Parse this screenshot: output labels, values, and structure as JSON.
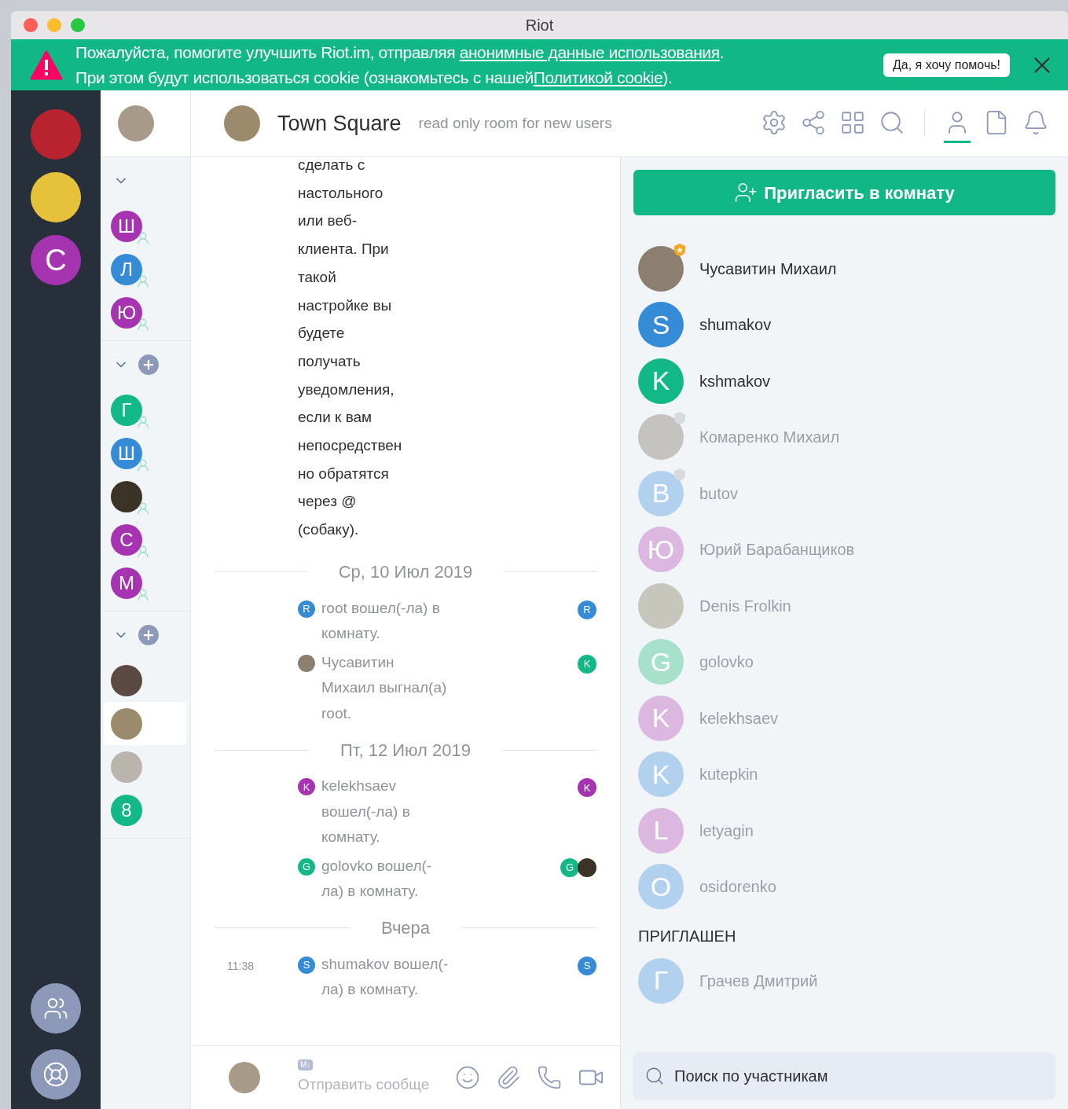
{
  "window": {
    "title": "Riot"
  },
  "banner": {
    "line1": [
      {
        "text": "Пожалуйста, помогите улучшить Riot.im, отправляя ",
        "kind": "plain"
      },
      {
        "text": "анонимные данные использования",
        "kind": "link"
      },
      {
        "text": ".",
        "kind": "plain"
      }
    ],
    "line2": [
      {
        "text": "При этом будут использоваться cookie (ознакомьтесь с нашей",
        "kind": "plain"
      },
      {
        "text": "Политикой cookie",
        "kind": "link"
      },
      {
        "text": ").",
        "kind": "plain"
      }
    ],
    "accept_button": "Да, я хочу помочь!"
  },
  "spaces": [
    {
      "kind": "photo",
      "color": "#b8232f"
    },
    {
      "kind": "photo",
      "color": "#e6c23a"
    },
    {
      "kind": "letter",
      "letter": "C",
      "color": "#a633b0"
    }
  ],
  "room_list": {
    "sections": [
      {
        "expanded": true,
        "can_add": false,
        "rooms": [
          {
            "kind": "letter",
            "letter": "Ш",
            "color": "#a633b0",
            "dm": true,
            "selected": false
          },
          {
            "kind": "letter",
            "letter": "Л",
            "color": "#368bd6",
            "dm": true,
            "selected": false
          },
          {
            "kind": "letter",
            "letter": "Ю",
            "color": "#a633b0",
            "dm": true,
            "selected": false
          }
        ]
      },
      {
        "expanded": true,
        "can_add": true,
        "rooms": [
          {
            "kind": "letter",
            "letter": "Г",
            "color": "#12b886",
            "dm": true,
            "selected": false
          },
          {
            "kind": "letter",
            "letter": "Ш",
            "color": "#368bd6",
            "dm": true,
            "selected": false
          },
          {
            "kind": "photo",
            "color": "#3b3326",
            "dm": true,
            "selected": false
          },
          {
            "kind": "letter",
            "letter": "С",
            "color": "#a633b0",
            "dm": true,
            "selected": false
          },
          {
            "kind": "letter",
            "letter": "М",
            "color": "#a633b0",
            "dm": true,
            "selected": false
          }
        ]
      },
      {
        "expanded": true,
        "can_add": true,
        "rooms": [
          {
            "kind": "photo",
            "color": "#5b4a44",
            "dm": false,
            "selected": false
          },
          {
            "kind": "photo",
            "color": "#9c8a6c",
            "dm": false,
            "selected": true
          },
          {
            "kind": "photo",
            "color": "#b9b4ac",
            "dm": false,
            "selected": false
          },
          {
            "kind": "letter",
            "letter": "8",
            "color": "#12b886",
            "dm": false,
            "selected": false
          }
        ]
      }
    ]
  },
  "room_header": {
    "name": "Town Square",
    "topic": "read only room for new users",
    "tools": [
      {
        "kind": "settings",
        "selected": false
      },
      {
        "kind": "share",
        "selected": false
      },
      {
        "kind": "apps",
        "selected": false
      },
      {
        "kind": "search",
        "selected": false
      },
      {
        "kind": "members",
        "selected": true
      },
      {
        "kind": "files",
        "selected": false
      },
      {
        "kind": "notifications",
        "selected": false
      }
    ]
  },
  "timeline": [
    {
      "kind": "text",
      "text": "сделать с настольного или веб-клиента. При такой настройке вы будете получать уведомления, если к вам непосредственно обратятся через @ (собаку)."
    },
    {
      "kind": "date",
      "text": "Ср, 10 Июл 2019"
    },
    {
      "kind": "event",
      "avatar": {
        "kind": "letter",
        "letter": "R",
        "color": "#368bd6"
      },
      "text": "root вошел(-ла) в комнату.",
      "receipts": [
        {
          "kind": "letter",
          "letter": "R",
          "color": "#368bd6"
        }
      ]
    },
    {
      "kind": "event",
      "avatar": {
        "kind": "photo",
        "color": "#8d7f70"
      },
      "text": "Чусавитин Михаил выгнал(а) root.",
      "receipts": [
        {
          "kind": "letter",
          "letter": "K",
          "color": "#12b886"
        }
      ]
    },
    {
      "kind": "date",
      "text": "Пт, 12 Июл 2019"
    },
    {
      "kind": "event",
      "avatar": {
        "kind": "letter",
        "letter": "K",
        "color": "#a633b0"
      },
      "text": "kelekhsaev вошел(-ла) в комнату.",
      "receipts": [
        {
          "kind": "letter",
          "letter": "K",
          "color": "#a633b0"
        }
      ]
    },
    {
      "kind": "event",
      "avatar": {
        "kind": "letter",
        "letter": "G",
        "color": "#12b886"
      },
      "text": "golovko вошел(-ла) в комнату.",
      "receipts": [
        {
          "kind": "letter",
          "letter": "G",
          "color": "#12b886"
        },
        {
          "kind": "photo",
          "color": "#3b3326"
        }
      ]
    },
    {
      "kind": "date",
      "text": "Вчера"
    },
    {
      "kind": "event",
      "time": "11:38",
      "avatar": {
        "kind": "letter",
        "letter": "S",
        "color": "#368bd6"
      },
      "text": "shumakov вошел(-ла) в комнату.",
      "receipts": [
        {
          "kind": "letter",
          "letter": "S",
          "color": "#368bd6"
        }
      ]
    }
  ],
  "composer": {
    "format_badge": "M↓",
    "placeholder": "Отправить сообще"
  },
  "members": {
    "invite_button": "Пригласить в комнату",
    "joined": [
      {
        "name": "Чусавитин Михаил",
        "avatar": {
          "kind": "photo",
          "color": "#8d7f70"
        },
        "admin": true,
        "moderator": false,
        "dimmed": false
      },
      {
        "name": "shumakov",
        "avatar": {
          "kind": "letter",
          "letter": "S",
          "color": "#368bd6"
        },
        "admin": false,
        "moderator": false,
        "dimmed": false
      },
      {
        "name": "kshmakov",
        "avatar": {
          "kind": "letter",
          "letter": "K",
          "color": "#12b886"
        },
        "admin": false,
        "moderator": false,
        "dimmed": false
      },
      {
        "name": "Комаренко Михаил",
        "avatar": {
          "kind": "photo",
          "color": "#c4c3c0"
        },
        "admin": false,
        "moderator": true,
        "dimmed": true
      },
      {
        "name": "butov",
        "avatar": {
          "kind": "letter",
          "letter": "B",
          "color": "#b2d1ee"
        },
        "admin": false,
        "moderator": true,
        "dimmed": true
      },
      {
        "name": "Юрий Барабанщиков",
        "avatar": {
          "kind": "letter",
          "letter": "Ю",
          "color": "#dcb8e0"
        },
        "admin": false,
        "moderator": false,
        "dimmed": true
      },
      {
        "name": "Denis Frolkin",
        "avatar": {
          "kind": "photo",
          "color": "#c6c6bc"
        },
        "admin": false,
        "moderator": false,
        "dimmed": true
      },
      {
        "name": "golovko",
        "avatar": {
          "kind": "letter",
          "letter": "G",
          "color": "#a7e1cc"
        },
        "admin": false,
        "moderator": false,
        "dimmed": true
      },
      {
        "name": "kelekhsaev",
        "avatar": {
          "kind": "letter",
          "letter": "K",
          "color": "#dcb8e0"
        },
        "admin": false,
        "moderator": false,
        "dimmed": true
      },
      {
        "name": "kutepkin",
        "avatar": {
          "kind": "letter",
          "letter": "K",
          "color": "#b2d1ee"
        },
        "admin": false,
        "moderator": false,
        "dimmed": true
      },
      {
        "name": "letyagin",
        "avatar": {
          "kind": "letter",
          "letter": "L",
          "color": "#dcb8e0"
        },
        "admin": false,
        "moderator": false,
        "dimmed": true
      },
      {
        "name": "osidorenko",
        "avatar": {
          "kind": "letter",
          "letter": "O",
          "color": "#b2d1ee"
        },
        "admin": false,
        "moderator": false,
        "dimmed": true
      }
    ],
    "invited_heading": "ПРИГЛАШЕН",
    "invited": [
      {
        "name": "Грачев Дмитрий",
        "avatar": {
          "kind": "letter",
          "letter": "Г",
          "color": "#b2d1ee"
        },
        "admin": false,
        "moderator": false,
        "dimmed": true
      }
    ],
    "search_placeholder": "Поиск по участникам"
  }
}
